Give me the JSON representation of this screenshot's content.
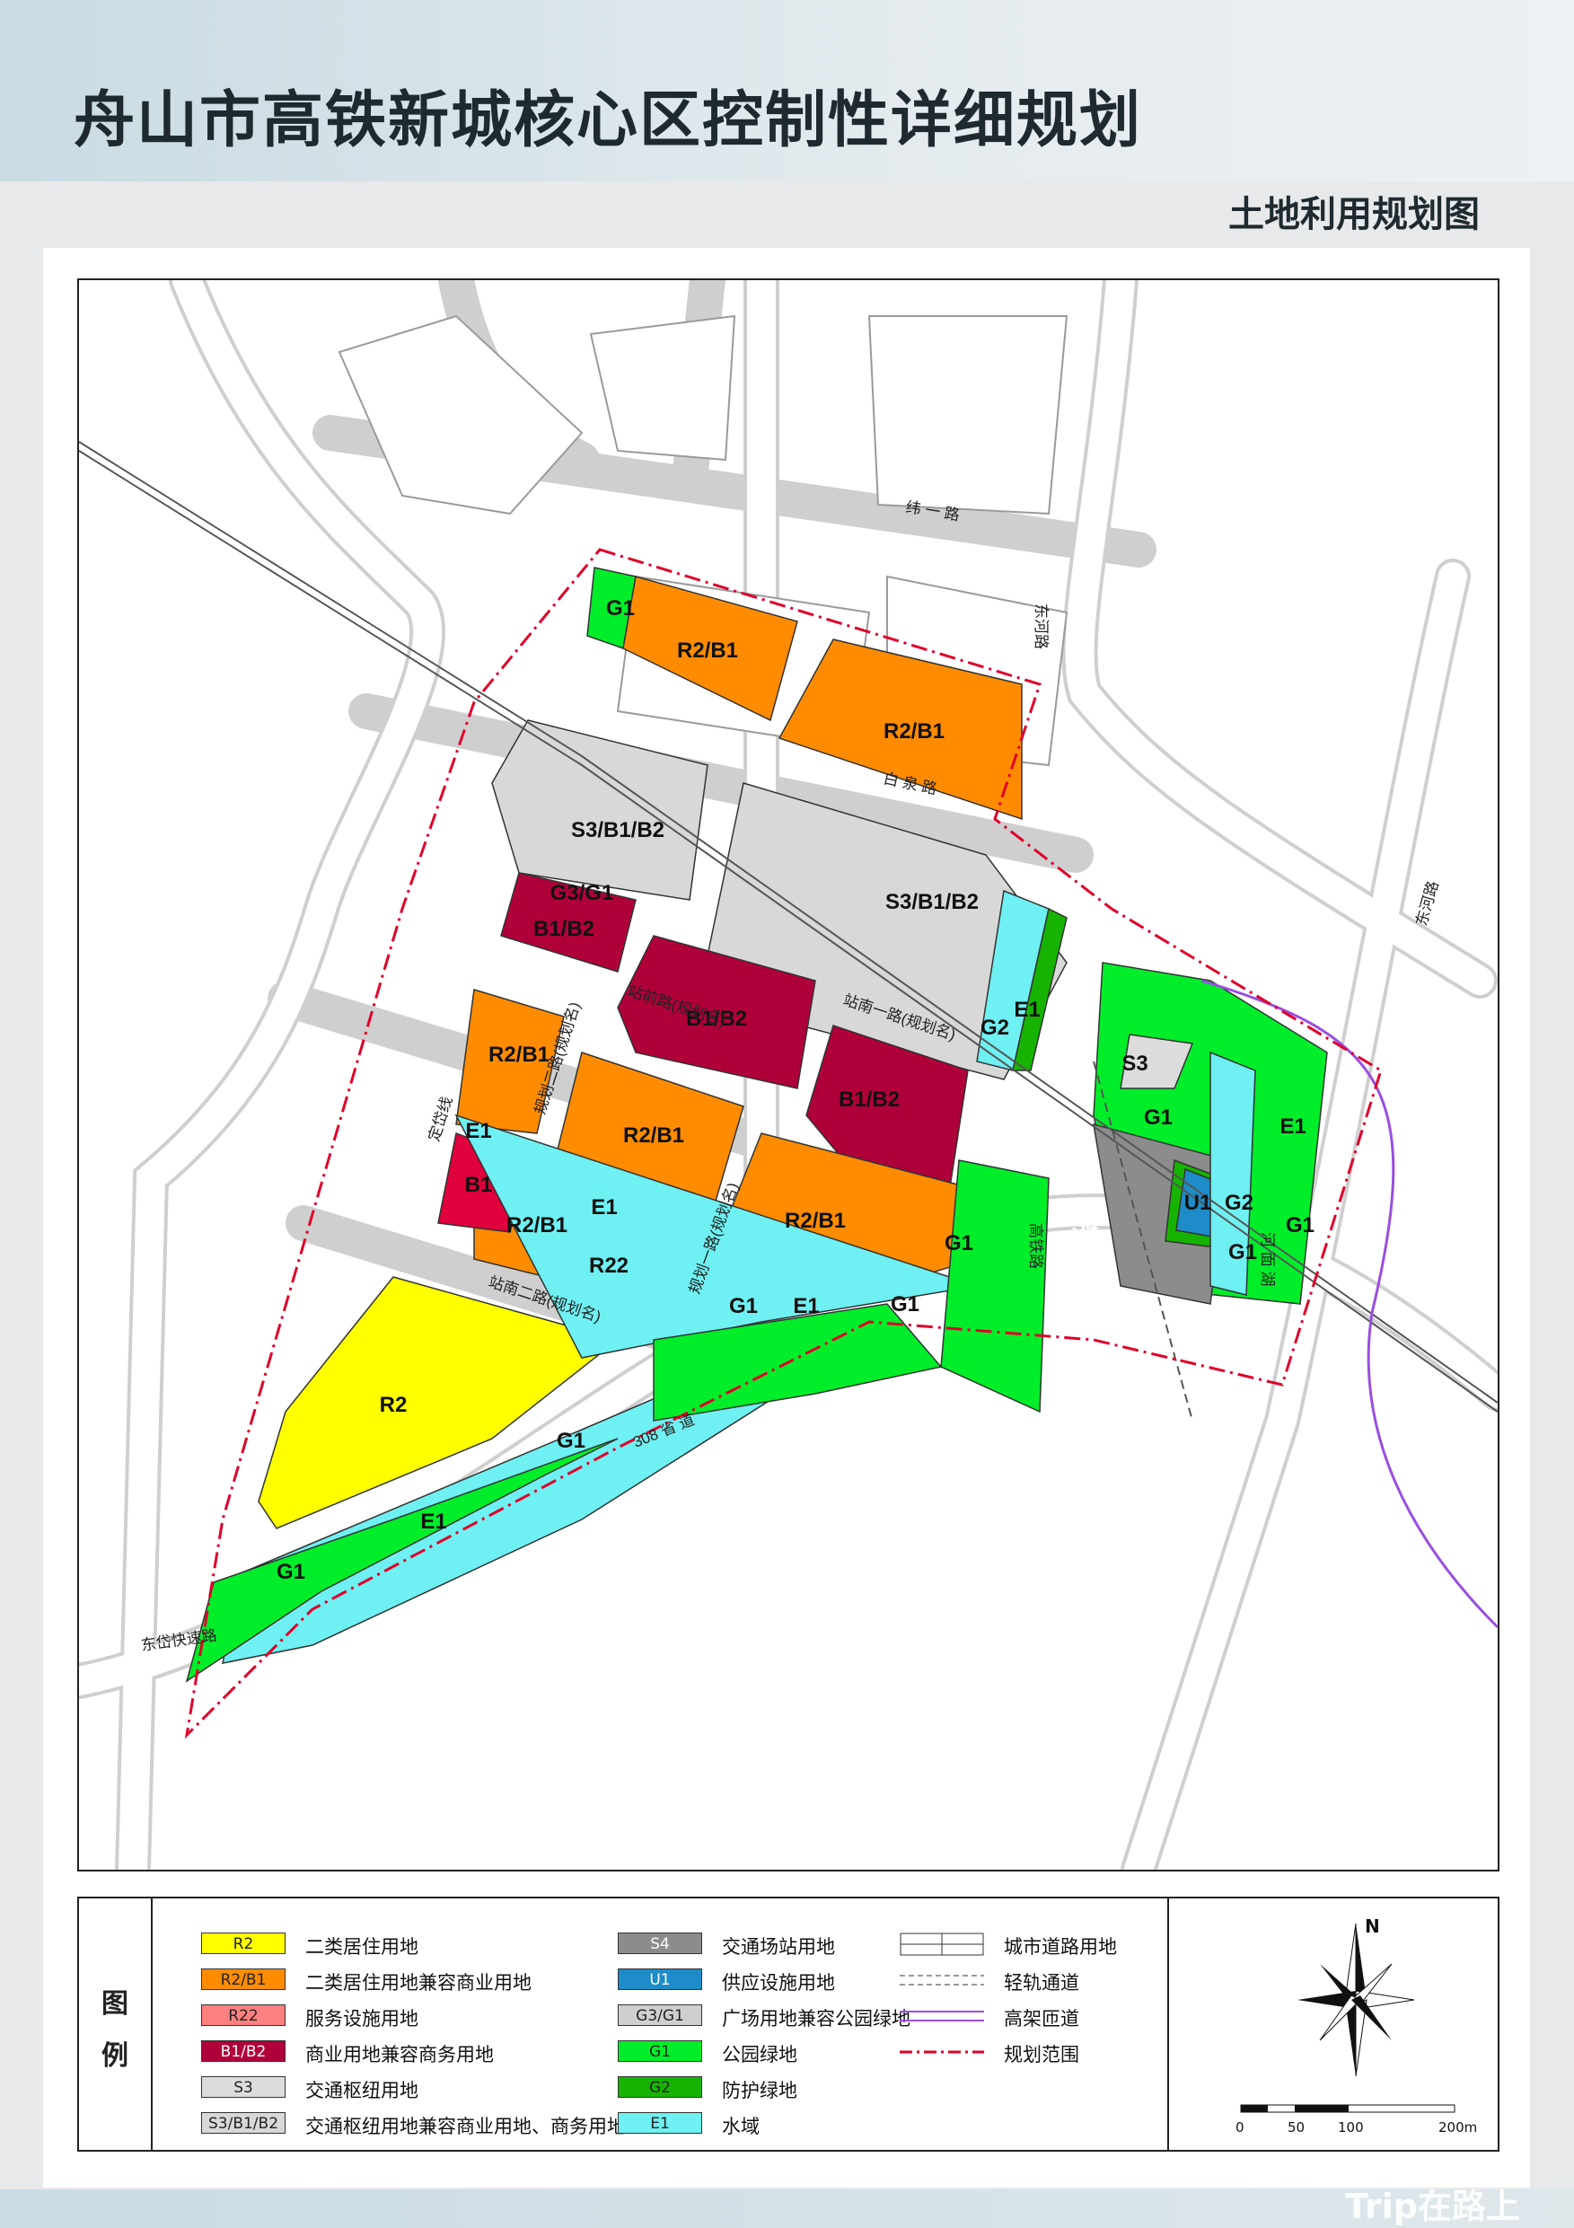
{
  "header": {
    "title": "舟山市高铁新城核心区控制性详细规划",
    "subtitle": "土地利用规划图"
  },
  "colors": {
    "R2": "#ffff00",
    "R2_B1": "#ff8c00",
    "R22": "#ff8080",
    "B1_B2": "#b0003a",
    "B1": "#e0003c",
    "S3": "#dcdcdc",
    "S3_B1_B2": "#d8d8d8",
    "S4": "#8c8c8c",
    "U1": "#1e8cc8",
    "G1": "#00ee2a",
    "G2": "#16b400",
    "G3_G1": "#cfcfcf",
    "E1": "#6ff0f2",
    "boundary": "#e0002a",
    "road": "#d0d0d0",
    "elevated": "#9a4ee0"
  },
  "map": {
    "parcels": {
      "g1_north": "G1",
      "r2b1_north_left": "R2/B1",
      "r2b1_north_right": "R2/B1",
      "s3_left": "S3/B1/B2",
      "s3_right": "S3/B1/B2",
      "g3g1": "G3/G1",
      "b1b2_a": "B1/B2",
      "b1b2_b": "B1/B2",
      "b1b2_c": "B1/B2",
      "r2b1_w": "R2/B1",
      "r2b1_c": "R2/B1",
      "r2b1_sw": "R2/B1",
      "r2b1_s": "R2/B1",
      "b1": "B1",
      "r22": "R22",
      "r2": "R2",
      "s3": "S3",
      "s4": "S4",
      "u1": "U1",
      "g2_a": "G2",
      "g2_b": "G2",
      "e1_a": "E1",
      "e1_b": "E1",
      "e1_c": "E1",
      "e1_d": "E1",
      "e1_e": "E1",
      "g1_a": "G1",
      "g1_b": "G1",
      "g1_c": "G1",
      "g1_d": "G1",
      "g1_e": "G1",
      "g1_f": "G1",
      "g1_g": "G1",
      "g1_h": "G1"
    },
    "roads": {
      "weiyi": "纬 一 路",
      "dongyun": "东河路",
      "baiquan": "白 泉 路",
      "dongyun2": "东河路",
      "zhanqian": "站前路(规划名)",
      "zhannan1": "站南一路(规划名)",
      "zhannan2": "站南二路(规划名)",
      "guihua2": "规划二路(规划名)",
      "guihua1": "规划一路(规划名)",
      "gaotie": "高铁路",
      "dinghai": "定岱线",
      "guodao": "308 省 道",
      "dongdai": "东岱快速路",
      "hemian": "河 面 湖"
    }
  },
  "legend": {
    "title_1": "图",
    "title_2": "例",
    "col1": [
      {
        "code": "R2",
        "label": "二类居住用地"
      },
      {
        "code": "R2/B1",
        "label": "二类居住用地兼容商业用地"
      },
      {
        "code": "R22",
        "label": "服务设施用地"
      },
      {
        "code": "B1/B2",
        "label": "商业用地兼容商务用地"
      },
      {
        "code": "S3",
        "label": "交通枢纽用地"
      },
      {
        "code": "S3/B1/B2",
        "label": "交通枢纽用地兼容商业用地、商务用地"
      }
    ],
    "col2": [
      {
        "code": "S4",
        "label": "交通场站用地"
      },
      {
        "code": "U1",
        "label": "供应设施用地"
      },
      {
        "code": "G3/G1",
        "label": "广场用地兼容公园绿地"
      },
      {
        "code": "G1",
        "label": "公园绿地"
      },
      {
        "code": "G2",
        "label": "防护绿地"
      },
      {
        "code": "E1",
        "label": "水域"
      }
    ],
    "col3": [
      {
        "label": "城市道路用地"
      },
      {
        "label": "轻轨通道"
      },
      {
        "label": "高架匝道"
      },
      {
        "label": "规划范围"
      }
    ],
    "north": "N",
    "scale": {
      "t0": "0",
      "t1": "50",
      "t2": "100",
      "t3": "200m"
    }
  },
  "watermark": "Trip在路上"
}
